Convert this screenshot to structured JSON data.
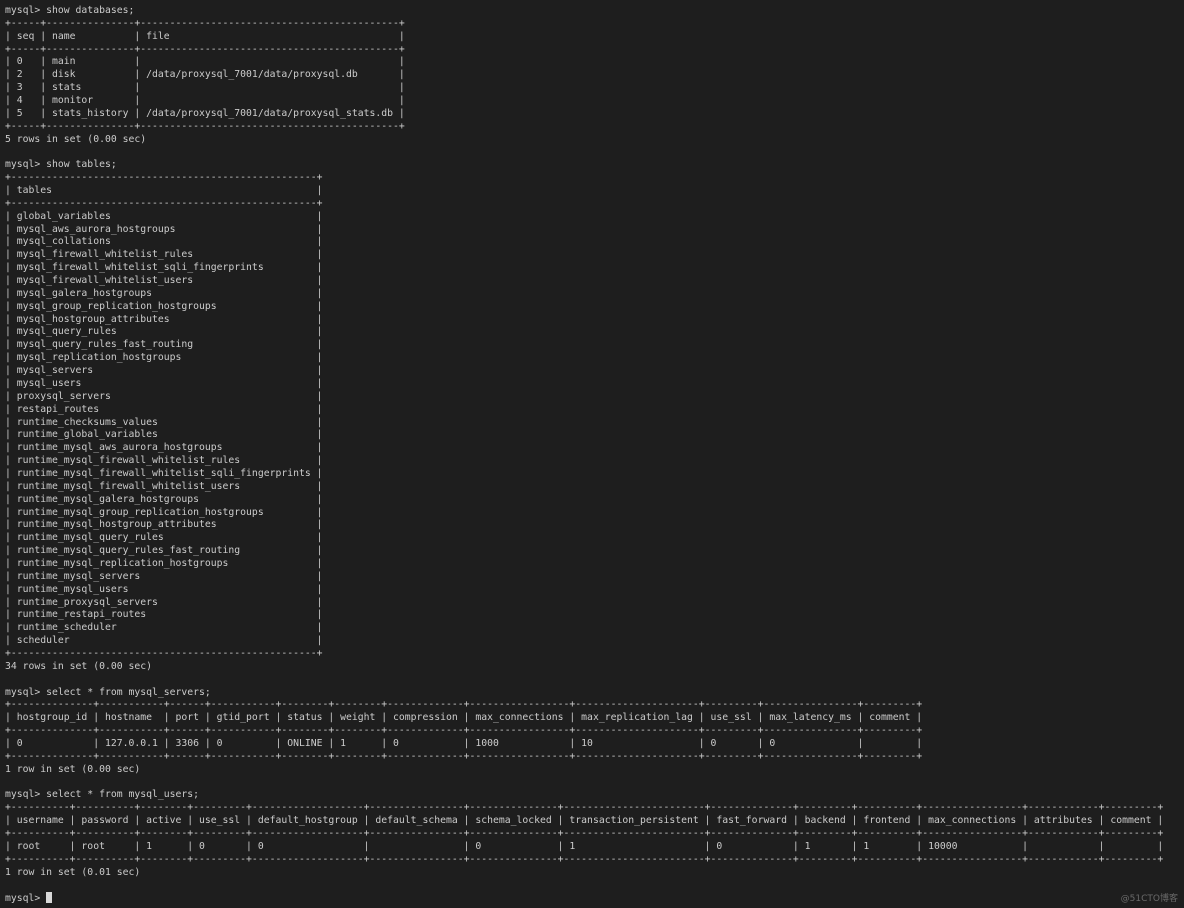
{
  "terminal": {
    "background": "#1e1e1e",
    "foreground": "#cccccc",
    "prompt": "mysql> ",
    "blocks": [
      {
        "command": "show databases;",
        "headers": [
          "seq",
          "name",
          "file"
        ],
        "rows": [
          [
            "0",
            "main",
            ""
          ],
          [
            "2",
            "disk",
            "/data/proxysql_7001/data/proxysql.db"
          ],
          [
            "3",
            "stats",
            ""
          ],
          [
            "4",
            "monitor",
            ""
          ],
          [
            "5",
            "stats_history",
            "/data/proxysql_7001/data/proxysql_stats.db"
          ]
        ],
        "footer": "5 rows in set (0.00 sec)"
      },
      {
        "command": "show tables;",
        "headers": [
          "tables"
        ],
        "rows": [
          [
            "global_variables"
          ],
          [
            "mysql_aws_aurora_hostgroups"
          ],
          [
            "mysql_collations"
          ],
          [
            "mysql_firewall_whitelist_rules"
          ],
          [
            "mysql_firewall_whitelist_sqli_fingerprints"
          ],
          [
            "mysql_firewall_whitelist_users"
          ],
          [
            "mysql_galera_hostgroups"
          ],
          [
            "mysql_group_replication_hostgroups"
          ],
          [
            "mysql_hostgroup_attributes"
          ],
          [
            "mysql_query_rules"
          ],
          [
            "mysql_query_rules_fast_routing"
          ],
          [
            "mysql_replication_hostgroups"
          ],
          [
            "mysql_servers"
          ],
          [
            "mysql_users"
          ],
          [
            "proxysql_servers"
          ],
          [
            "restapi_routes"
          ],
          [
            "runtime_checksums_values"
          ],
          [
            "runtime_global_variables"
          ],
          [
            "runtime_mysql_aws_aurora_hostgroups"
          ],
          [
            "runtime_mysql_firewall_whitelist_rules"
          ],
          [
            "runtime_mysql_firewall_whitelist_sqli_fingerprints"
          ],
          [
            "runtime_mysql_firewall_whitelist_users"
          ],
          [
            "runtime_mysql_galera_hostgroups"
          ],
          [
            "runtime_mysql_group_replication_hostgroups"
          ],
          [
            "runtime_mysql_hostgroup_attributes"
          ],
          [
            "runtime_mysql_query_rules"
          ],
          [
            "runtime_mysql_query_rules_fast_routing"
          ],
          [
            "runtime_mysql_replication_hostgroups"
          ],
          [
            "runtime_mysql_servers"
          ],
          [
            "runtime_mysql_users"
          ],
          [
            "runtime_proxysql_servers"
          ],
          [
            "runtime_restapi_routes"
          ],
          [
            "runtime_scheduler"
          ],
          [
            "scheduler"
          ]
        ],
        "footer": "34 rows in set (0.00 sec)"
      },
      {
        "command": "select * from mysql_servers;",
        "headers": [
          "hostgroup_id",
          "hostname",
          "port",
          "gtid_port",
          "status",
          "weight",
          "compression",
          "max_connections",
          "max_replication_lag",
          "use_ssl",
          "max_latency_ms",
          "comment"
        ],
        "rows": [
          [
            "0",
            "127.0.0.1",
            "3306",
            "0",
            "ONLINE",
            "1",
            "0",
            "1000",
            "10",
            "0",
            "0",
            ""
          ]
        ],
        "footer": "1 row in set (0.00 sec)"
      },
      {
        "command": "select * from mysql_users;",
        "headers": [
          "username",
          "password",
          "active",
          "use_ssl",
          "default_hostgroup",
          "default_schema",
          "schema_locked",
          "transaction_persistent",
          "fast_forward",
          "backend",
          "frontend",
          "max_connections",
          "attributes",
          "comment"
        ],
        "rows": [
          [
            "root",
            "root",
            "1",
            "0",
            "0",
            "",
            "0",
            "1",
            "0",
            "1",
            "1",
            "10000",
            "",
            ""
          ]
        ],
        "footer": "1 row in set (0.01 sec)"
      }
    ]
  },
  "watermark": "@51CTO博客"
}
